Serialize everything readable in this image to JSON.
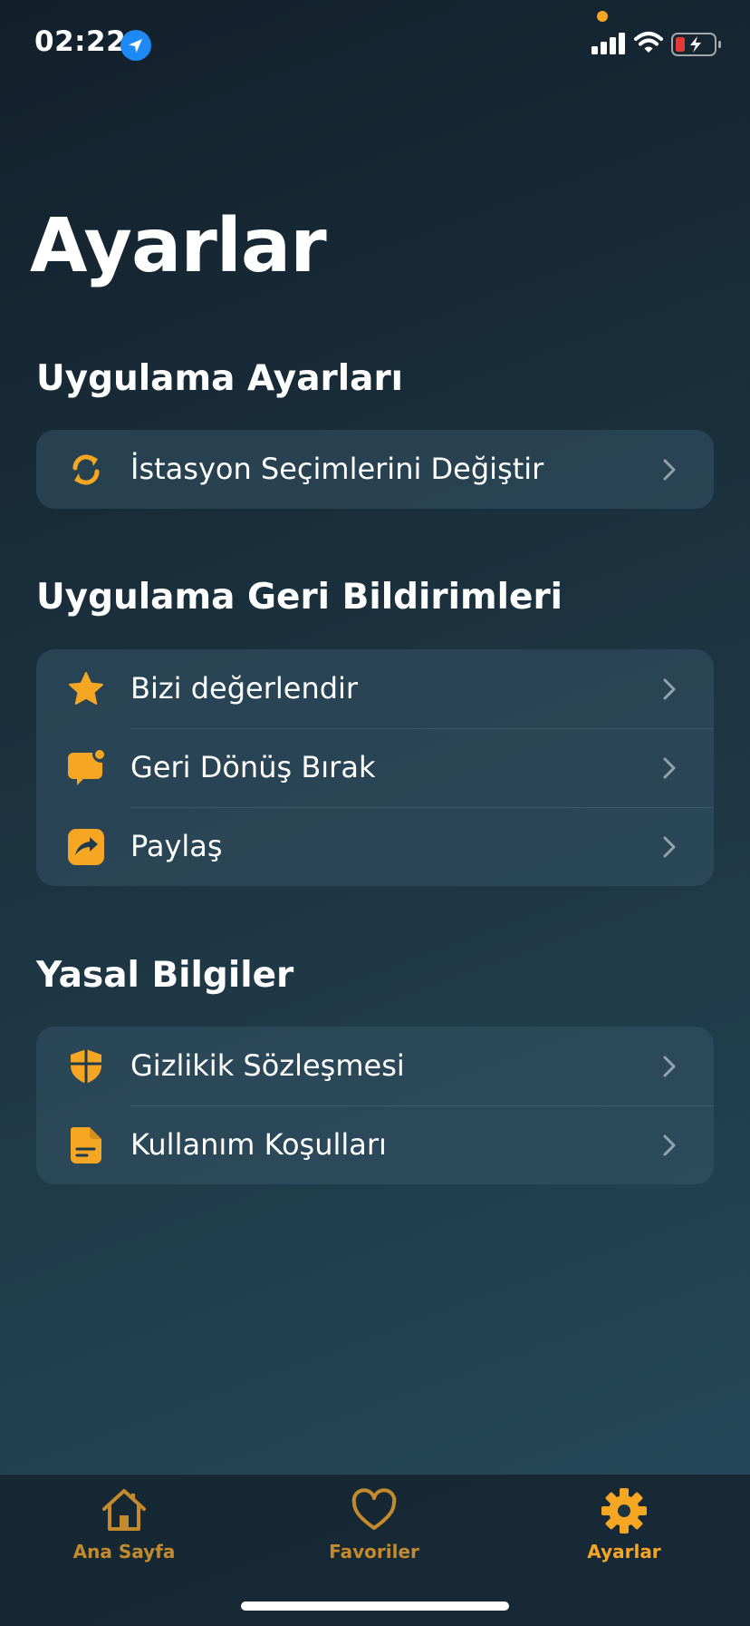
{
  "status_bar": {
    "time": "02:22",
    "icons": [
      "location-arrow-icon",
      "cellular-signal-icon",
      "wifi-icon",
      "battery-charging-icon"
    ],
    "recording_dot_color": "#f5a623",
    "battery_color": "#e53935"
  },
  "page": {
    "title": "Ayarlar"
  },
  "sections": [
    {
      "title": "Uygulama Ayarları",
      "items": [
        {
          "label": "İstasyon Seçimlerini Değiştir",
          "icon": "sync-icon"
        }
      ]
    },
    {
      "title": "Uygulama Geri Bildirimleri",
      "items": [
        {
          "label": "Bizi değerlendir",
          "icon": "star-icon"
        },
        {
          "label": "Geri Dönüş Bırak",
          "icon": "message-icon"
        },
        {
          "label": "Paylaş",
          "icon": "share-icon"
        }
      ]
    },
    {
      "title": "Yasal Bilgiler",
      "items": [
        {
          "label": "Gizlikik Sözleşmesi",
          "icon": "shield-icon"
        },
        {
          "label": "Kullanım Koşulları",
          "icon": "document-icon"
        }
      ]
    }
  ],
  "tab_bar": {
    "tabs": [
      {
        "label": "Ana Sayfa",
        "icon": "home-icon",
        "active": false
      },
      {
        "label": "Favoriler",
        "icon": "heart-icon",
        "active": false
      },
      {
        "label": "Ayarlar",
        "icon": "gear-icon",
        "active": true
      }
    ]
  },
  "colors": {
    "accent": "#f5a623",
    "inactive_tab": "#c48a2e",
    "card": "#2d4b5c"
  }
}
